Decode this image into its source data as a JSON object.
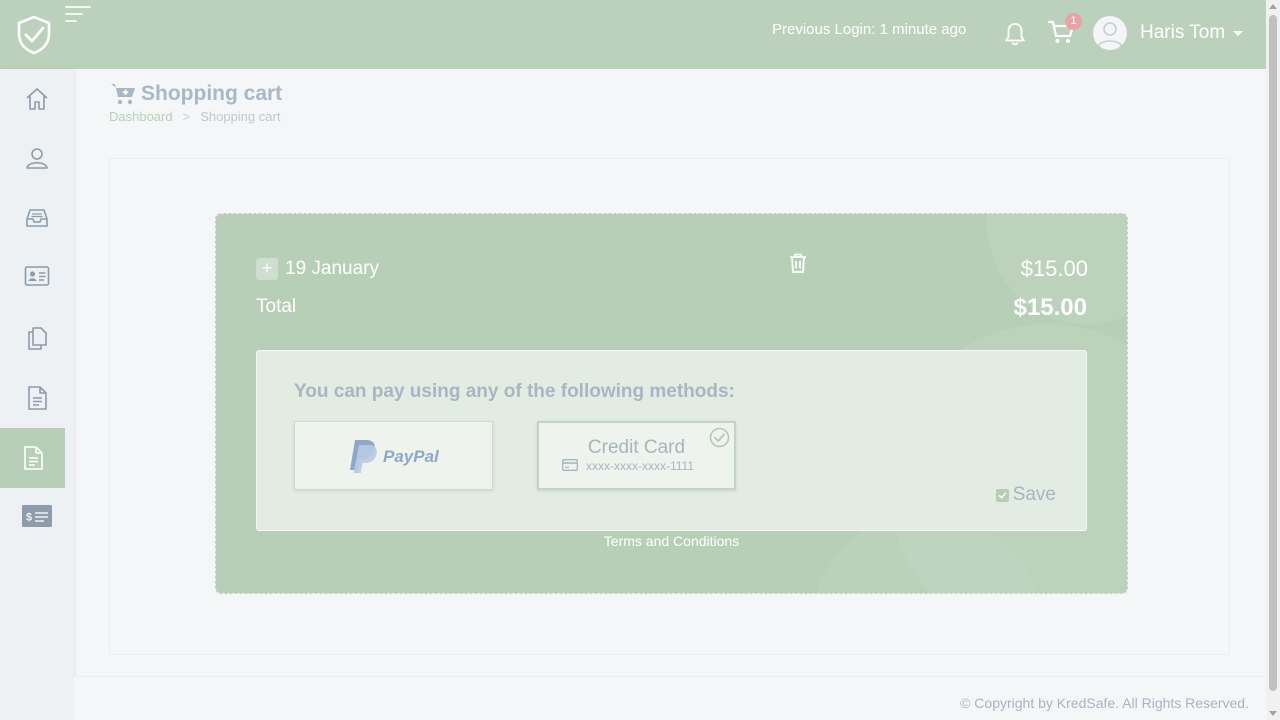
{
  "header": {
    "previous_login": "Previous Login: 1 minute ago",
    "cart_count": "1",
    "user_name": "Haris Tom"
  },
  "sidebar": {
    "items": [
      {
        "icon": "home-icon"
      },
      {
        "icon": "user-icon"
      },
      {
        "icon": "inbox-icon"
      },
      {
        "icon": "id-card-icon"
      },
      {
        "icon": "copy-icon"
      },
      {
        "icon": "document-icon"
      },
      {
        "icon": "document-active-icon"
      },
      {
        "icon": "money-icon"
      }
    ]
  },
  "page": {
    "title": "Shopping cart",
    "breadcrumb": {
      "home": "Dashboard",
      "separator": ">",
      "current": "Shopping cart"
    }
  },
  "cart": {
    "item": {
      "plus": "+",
      "date": "19 January",
      "price": "$15.00"
    },
    "total_label": "Total",
    "total_value": "$15.00",
    "payment": {
      "heading": "You can pay using any of the following methods:",
      "paypal_label": "PayPal",
      "credit_card": {
        "title": "Credit Card",
        "number": "xxxx-xxxx-xxxx-1111",
        "selected": true
      },
      "save_label": "Save",
      "save_checked": true
    },
    "terms": "Terms and Conditions"
  },
  "footer": {
    "copyright": "© Copyright by KredSafe. All Rights Reserved."
  },
  "colors": {
    "accent": "#bcd1bb",
    "badge": "#e8a3a7"
  }
}
